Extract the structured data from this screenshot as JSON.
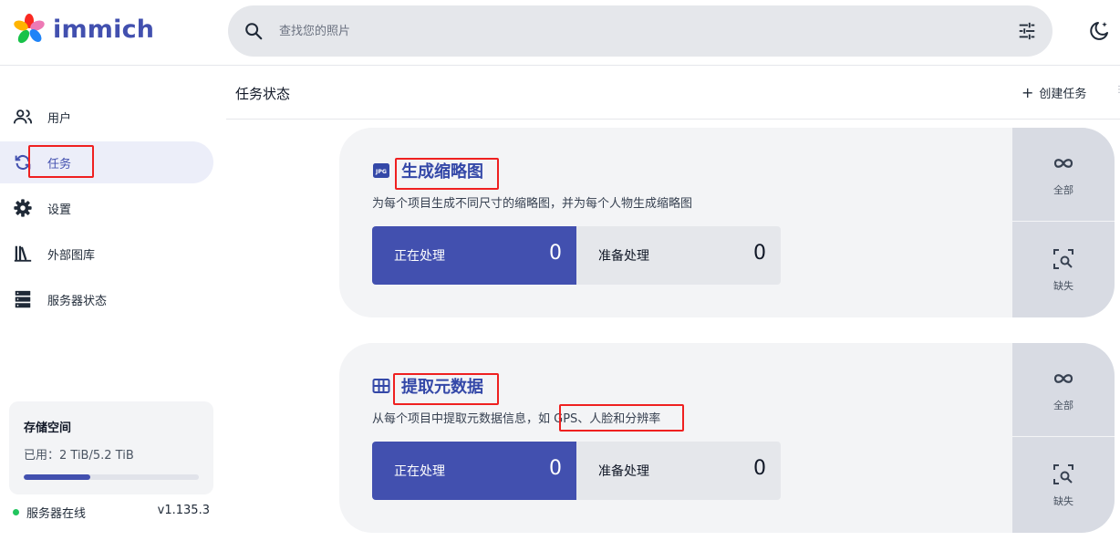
{
  "app": {
    "name": "immich"
  },
  "search": {
    "placeholder": "查找您的照片"
  },
  "sidebar": {
    "items": [
      {
        "label": "用户",
        "icon": "users-icon"
      },
      {
        "label": "任务",
        "icon": "sync-icon",
        "active": true
      },
      {
        "label": "设置",
        "icon": "gear-icon"
      },
      {
        "label": "外部图库",
        "icon": "library-icon"
      },
      {
        "label": "服务器状态",
        "icon": "server-icon"
      }
    ],
    "storage": {
      "title": "存储空间",
      "used_text": "已用：2 TiB/5.2 TiB",
      "used_fraction": 0.38
    },
    "server": {
      "status": "服务器在线",
      "version": "v1.135.3"
    }
  },
  "page": {
    "title": "任务状态",
    "create_job": "创建任务"
  },
  "jobs": [
    {
      "title": "生成缩略图",
      "icon": "jpg-file-icon",
      "description": "为每个项目生成不同尺寸的缩略图，并为每个人物生成缩略图",
      "active_label": "正在处理",
      "active_count": "0",
      "waiting_label": "准备处理",
      "waiting_count": "0",
      "action_all": "全部",
      "action_missing": "缺失"
    },
    {
      "title": "提取元数据",
      "icon": "table-icon",
      "description": "从每个项目中提取元数据信息，如 GPS、人脸和分辨率",
      "active_label": "正在处理",
      "active_count": "0",
      "waiting_label": "准备处理",
      "waiting_count": "0",
      "action_all": "全部",
      "action_missing": "缺失"
    }
  ],
  "colors": {
    "accent": "#4250af",
    "highlight": "#ef2020",
    "online": "#22c55e"
  }
}
